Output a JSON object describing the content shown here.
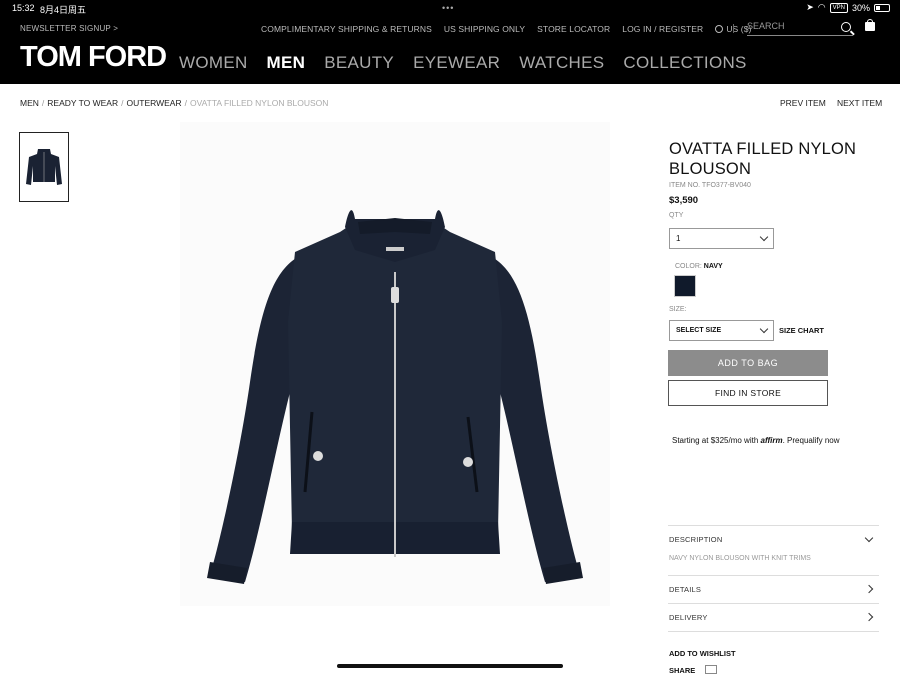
{
  "status": {
    "time": "15:32",
    "date": "8月4日周五",
    "battery": "30%",
    "vpn": "VPN"
  },
  "header": {
    "newsletter": "NEWSLETTER SIGNUP >",
    "utility": [
      "COMPLIMENTARY SHIPPING & RETURNS",
      "US SHIPPING ONLY",
      "STORE LOCATOR",
      "LOG IN / REGISTER"
    ],
    "locale": "US ($)",
    "search_placeholder": "SEARCH",
    "logo": "TOM FORD",
    "nav": [
      "WOMEN",
      "MEN",
      "BEAUTY",
      "EYEWEAR",
      "WATCHES",
      "COLLECTIONS"
    ],
    "active_nav": "MEN"
  },
  "breadcrumb": {
    "items": [
      "MEN",
      "READY TO WEAR",
      "OUTERWEAR"
    ],
    "current": "OVATTA FILLED NYLON BLOUSON"
  },
  "pager": {
    "prev": "PREV ITEM",
    "next": "NEXT ITEM"
  },
  "product": {
    "title": "OVATTA FILLED NYLON BLOUSON",
    "item_no": "ITEM NO. TFO377-BV040",
    "price": "$3,590",
    "qty_label": "QTY",
    "qty_value": "1",
    "color_label": "COLOR:",
    "color_value": "NAVY",
    "swatch_color": "#101a2b",
    "size_label": "SIZE:",
    "size_value": "SELECT SIZE",
    "size_chart": "SIZE CHART",
    "add_to_bag": "ADD TO BAG",
    "find_in_store": "FIND IN STORE",
    "affirm_prefix": "Starting at $325/mo with",
    "affirm_brand": "affirm",
    "affirm_suffix": ". Prequalify now"
  },
  "accordion": {
    "description_label": "DESCRIPTION",
    "description_text": "NAVY NYLON BLOUSON WITH KNIT TRIMS",
    "details_label": "DETAILS",
    "delivery_label": "DELIVERY"
  },
  "actions": {
    "wishlist": "ADD TO WISHLIST",
    "share": "SHARE"
  }
}
